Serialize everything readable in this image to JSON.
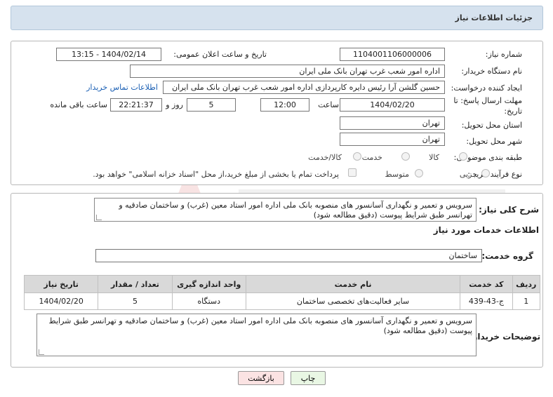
{
  "header": {
    "title": "جزئیات اطلاعات نیاز"
  },
  "form": {
    "need_number_label": "شماره نیاز:",
    "need_number": "1104001106000006",
    "announce_label": "تاریخ و ساعت اعلان عمومی:",
    "announce_value": "1404/02/14 - 13:15",
    "buyer_org_label": "نام دستگاه خریدار:",
    "buyer_org": "اداره امور شعب غرب تهران بانک ملی ایران",
    "requester_label": "ایجاد کننده درخواست:",
    "requester": "حسین گلشن آرا رئیس دایره کارپردازی اداره امور شعب غرب تهران بانک ملی ایران",
    "contact_link": "اطلاعات تماس خریدار",
    "deadline_label_1": "مهلت ارسال پاسخ: تا",
    "deadline_label_2": "تاریخ:",
    "deadline_date": "1404/02/20",
    "time_label": "ساعت",
    "deadline_time": "12:00",
    "days_value": "5",
    "days_label": "روز و",
    "remaining_time": "22:21:37",
    "remaining_label": "ساعت باقی مانده",
    "province_label": "استان محل تحویل:",
    "province": "تهران",
    "city_label": "شهر محل تحویل:",
    "city": "تهران",
    "category_label": "طبقه بندی موضوعی:",
    "category_options": [
      "کالا",
      "خدمت",
      "کالا/خدمت"
    ],
    "process_label": "نوع فرآیند خرید :",
    "process_options": [
      "جزیی",
      "متوسط"
    ],
    "payment_note": "پرداخت تمام یا بخشی از مبلغ خرید،از محل \"اسناد خزانه اسلامی\" خواهد بود."
  },
  "summary": {
    "label": "شرح کلی نیاز:",
    "text": "سرویس و تعمیر و نگهداری آسانسور های منصوبه بانک ملی اداره امور استاد معین (غرب) و ساختمان صادقیه و تهرانسر طبق شرایط پیوست (دقیق مطالعه شود)"
  },
  "services": {
    "section_title": "اطلاعات خدمات مورد نیاز",
    "group_label": "گروه خدمت:",
    "group_value": "ساختمان",
    "columns": [
      "ردیف",
      "کد خدمت",
      "نام خدمت",
      "واحد اندازه گیری",
      "تعداد / مقدار",
      "تاریخ نیاز"
    ],
    "rows": [
      [
        "1",
        "ج-43-439",
        "سایر فعالیت‌های تخصصی ساختمان",
        "دستگاه",
        "5",
        "1404/02/20"
      ]
    ]
  },
  "buyer_notes": {
    "label": "توضیحات خریدار:",
    "text": "سرویس و تعمیر و نگهداری آسانسور های منصوبه بانک ملی اداره امور استاد معین (غرب) و ساختمان صادقیه و تهرانسر طبق شرایط پیوست (دقیق مطالعه شود)"
  },
  "buttons": {
    "print": "چاپ",
    "back": "بازگشت"
  },
  "colors": {
    "header_bg": "#d6e2ee",
    "link": "#1a5fb4",
    "print_bg": "#e9f7e4",
    "back_bg": "#fbe3e3"
  }
}
